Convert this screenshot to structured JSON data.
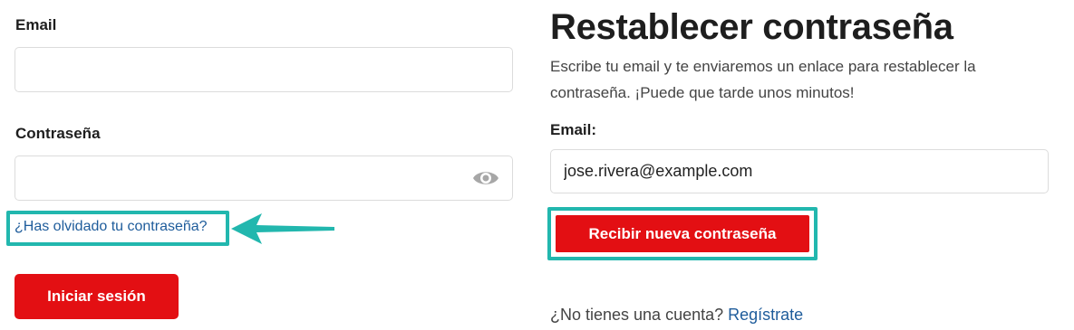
{
  "login": {
    "email_label": "Email",
    "email_value": "",
    "password_label": "Contraseña",
    "password_value": "",
    "forgot_link": "¿Has olvidado tu contraseña?",
    "login_button": "Iniciar sesión"
  },
  "reset": {
    "title": "Restablecer contraseña",
    "description": "Escribe tu email y te enviaremos un enlace para restablecer la contraseña. ¡Puede que tarde unos minutos!",
    "email_label": "Email:",
    "email_value": "jose.rivera@example.com",
    "submit_button": "Recibir nueva contraseña",
    "signup_prompt": "¿No tienes una cuenta?",
    "signup_link": "Regístrate"
  },
  "icons": {
    "password_toggle": "eye-icon",
    "annotation_arrow": "arrow-left-icon"
  },
  "colors": {
    "primary_red": "#e30f13",
    "highlight_teal": "#22b7ae",
    "link_blue": "#1e5c9b"
  }
}
